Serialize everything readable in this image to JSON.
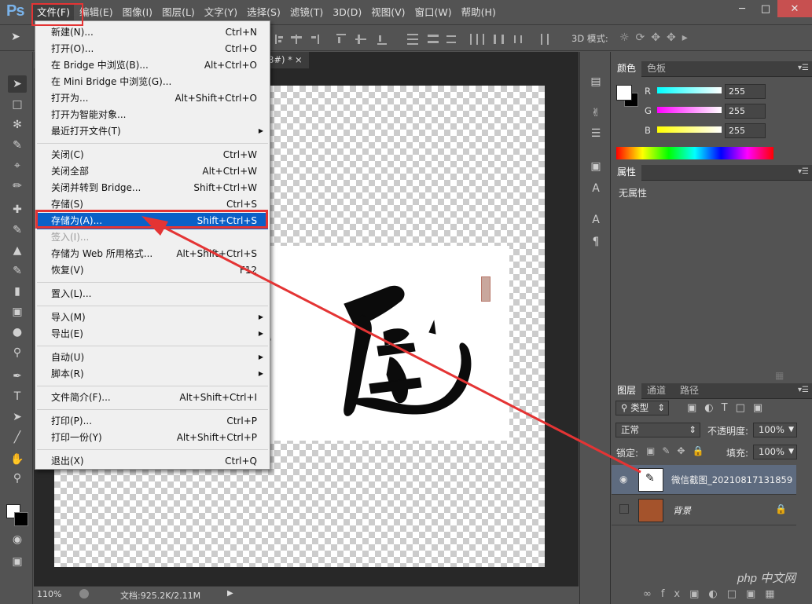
{
  "app": {
    "logo": "Ps"
  },
  "menubar": {
    "items": [
      "文件(F)",
      "编辑(E)",
      "图像(I)",
      "图层(L)",
      "文字(Y)",
      "选择(S)",
      "滤镜(T)",
      "3D(D)",
      "视图(V)",
      "窗口(W)",
      "帮助(H)"
    ]
  },
  "optionsbar": {
    "mode3d_label": "3D 模式:"
  },
  "document": {
    "tab_suffix": "8#) *",
    "close_symbol": "×"
  },
  "file_menu": {
    "items": [
      {
        "label": "新建(N)...",
        "shortcut": "Ctrl+N"
      },
      {
        "label": "打开(O)...",
        "shortcut": "Ctrl+O"
      },
      {
        "label": "在 Bridge 中浏览(B)...",
        "shortcut": "Alt+Ctrl+O"
      },
      {
        "label": "在 Mini Bridge 中浏览(G)...",
        "shortcut": ""
      },
      {
        "label": "打开为...",
        "shortcut": "Alt+Shift+Ctrl+O"
      },
      {
        "label": "打开为智能对象...",
        "shortcut": ""
      },
      {
        "label": "最近打开文件(T)",
        "shortcut": "",
        "submenu": true
      },
      {
        "label": "关闭(C)",
        "shortcut": "Ctrl+W"
      },
      {
        "label": "关闭全部",
        "shortcut": "Alt+Ctrl+W"
      },
      {
        "label": "关闭并转到 Bridge...",
        "shortcut": "Shift+Ctrl+W"
      },
      {
        "label": "存储(S)",
        "shortcut": "Ctrl+S"
      },
      {
        "label": "存储为(A)...",
        "shortcut": "Shift+Ctrl+S",
        "highlighted": true
      },
      {
        "label": "签入(I)...",
        "shortcut": "",
        "disabled": true
      },
      {
        "label": "存储为 Web 所用格式...",
        "shortcut": "Alt+Shift+Ctrl+S"
      },
      {
        "label": "恢复(V)",
        "shortcut": "F12"
      },
      {
        "label": "置入(L)...",
        "shortcut": ""
      },
      {
        "label": "导入(M)",
        "shortcut": "",
        "submenu": true
      },
      {
        "label": "导出(E)",
        "shortcut": "",
        "submenu": true
      },
      {
        "label": "自动(U)",
        "shortcut": "",
        "submenu": true
      },
      {
        "label": "脚本(R)",
        "shortcut": "",
        "submenu": true
      },
      {
        "label": "文件简介(F)...",
        "shortcut": "Alt+Shift+Ctrl+I"
      },
      {
        "label": "打印(P)...",
        "shortcut": "Ctrl+P"
      },
      {
        "label": "打印一份(Y)",
        "shortcut": "Alt+Shift+Ctrl+P"
      },
      {
        "label": "退出(X)",
        "shortcut": "Ctrl+Q"
      }
    ]
  },
  "color_panel": {
    "tabs": [
      "颜色",
      "色板"
    ],
    "channels": [
      {
        "name": "R",
        "value": "255"
      },
      {
        "name": "G",
        "value": "255"
      },
      {
        "name": "B",
        "value": "255"
      }
    ]
  },
  "properties_panel": {
    "tab": "属性",
    "empty_text": "无属性"
  },
  "layers_panel": {
    "tabs": [
      "图层",
      "通道",
      "路径"
    ],
    "filter_label": "类型",
    "blend_mode": "正常",
    "opacity_label": "不透明度:",
    "opacity_value": "100%",
    "lock_label": "锁定:",
    "fill_label": "填充:",
    "fill_value": "100%",
    "layers": [
      {
        "name": "微信截图_20210817131859"
      },
      {
        "name": "背景"
      }
    ]
  },
  "statusbar": {
    "zoom": "110%",
    "doc_info": "文档:925.2K/2.11M"
  },
  "watermark": "php 中文网",
  "colors": {
    "accent": "#0a60c7",
    "annotation": "#e43434",
    "panel_bg": "#535353"
  }
}
